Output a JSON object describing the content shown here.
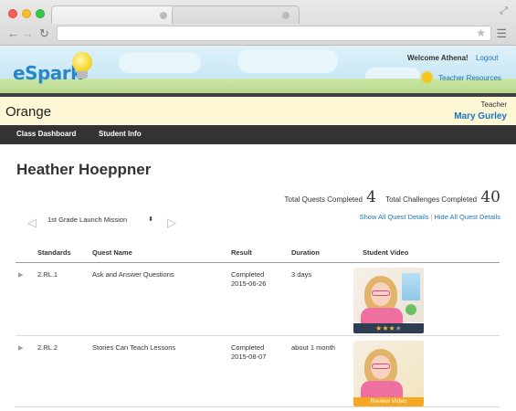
{
  "browser": {
    "tabs": [
      "",
      ""
    ]
  },
  "header": {
    "logo_text": "eSpark",
    "welcome": "Welcome Athena!",
    "logout": "Logout",
    "teacher_resources": "Teacher Resources"
  },
  "class_bar": {
    "class_name": "Orange",
    "teacher_label": "Teacher",
    "teacher_name": "Mary Gurley"
  },
  "nav": {
    "items": [
      "Class Dashboard",
      "Student Info"
    ]
  },
  "student": {
    "name": "Heather Hoeppner"
  },
  "summary": {
    "quests_label": "Total Quests Completed",
    "quests_value": "4",
    "challenges_label": "Total Challenges Completed",
    "challenges_value": "40",
    "show_all": "Show All Quest Details",
    "hide_all": "Hide All Quest Details"
  },
  "mission_select": {
    "selected": "1st Grade Launch Mission"
  },
  "table": {
    "headers": [
      "Standards",
      "Quest Name",
      "Result",
      "Duration",
      "Student Video"
    ],
    "rows": [
      {
        "standard": "2.RL.1",
        "quest": "Ask and Answer Questions",
        "result": "Completed",
        "date": "2015-06-26",
        "duration": "3 days",
        "video_rating": 3,
        "video_rating_max": 4
      },
      {
        "standard": "2.RL.2",
        "quest": "Stories Can Teach Lessons",
        "result": "Completed",
        "date": "2015-08-07",
        "duration": "about 1 month",
        "video_action": "Review Video"
      }
    ]
  },
  "colors": {
    "accent_blue": "#1b75bc",
    "nav_bg": "#333333",
    "info_bar_bg": "#fdf7d6",
    "review_button": "#f7a823",
    "rating_star": "#f5b82e"
  }
}
